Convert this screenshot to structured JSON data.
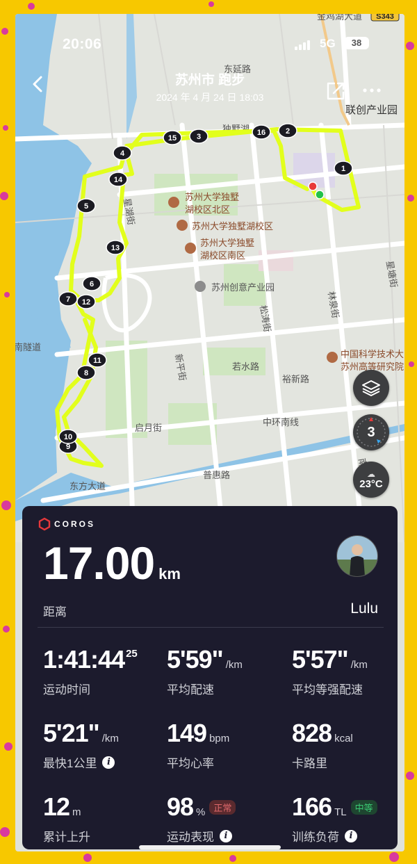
{
  "status_bar": {
    "time": "20:06",
    "network": "5G",
    "battery": "38"
  },
  "header": {
    "title": "苏州市 跑步",
    "date": "2024 年 4 月 24 日 18:03"
  },
  "map": {
    "place_labels": {
      "jinjihu": "金鸡湖大道",
      "road_badge": "S343",
      "dongyan": "东延路",
      "lianchuang": "联创产业园",
      "dushu_lake": "独墅湖",
      "univ_north": [
        "苏州大学独墅",
        "湖校区北区"
      ],
      "univ_main": "苏州大学独墅湖校区",
      "univ_south": [
        "苏州大学独墅",
        "湖校区南区"
      ],
      "creative": "苏州创意产业园",
      "xingjie": "星湖街",
      "linquan": "林泉街",
      "songtao": "松涛街",
      "xinghu2": "星塘街",
      "ruoshui": "若水路",
      "yuxin": "裕新路",
      "xinping": "新平街",
      "zhonghuan": "中环南线",
      "qiyue": "启月街",
      "puhui": "普惠路",
      "dongfang": "东方大道",
      "tunnel": "南隧道",
      "cas": [
        "中国科学技术大",
        "苏州高等研究院"
      ],
      "nanyi": "南道路"
    },
    "km_markers": [
      "1",
      "2",
      "3",
      "4",
      "5",
      "6",
      "7",
      "8",
      "9",
      "10",
      "11",
      "12",
      "13",
      "14",
      "15",
      "16"
    ],
    "route_color": "#e2ff1c",
    "start_color": "#24c14a",
    "end_color": "#e83a3a"
  },
  "controls": {
    "layers_icon": "layers-icon",
    "compass_value": "3",
    "weather_temp": "23°C"
  },
  "card": {
    "brand": "COROS",
    "distance": {
      "value": "17.00",
      "unit": "km",
      "label": "距离"
    },
    "user": {
      "name": "Lulu"
    },
    "stats": {
      "duration": {
        "value": "1:41:44",
        "sup": "25",
        "label": "运动时间"
      },
      "avg_pace": {
        "value": "5'59\"",
        "unit": "/km",
        "label": "平均配速"
      },
      "grade_pace": {
        "value": "5'57\"",
        "unit": "/km",
        "label": "平均等强配速"
      },
      "fastest_km": {
        "value": "5'21\"",
        "unit": "/km",
        "label": "最快1公里"
      },
      "heart_rate": {
        "value": "149",
        "unit": "bpm",
        "label": "平均心率"
      },
      "calories": {
        "value": "828",
        "unit": "kcal",
        "label": "卡路里"
      },
      "elevation": {
        "value": "12",
        "unit": "m",
        "label": "累计上升"
      },
      "performance": {
        "value": "98",
        "unit": "%",
        "badge": "正常",
        "label": "运动表现"
      },
      "training_load": {
        "value": "166",
        "unit": "TL",
        "badge": "中等",
        "label": "训练负荷"
      }
    }
  }
}
